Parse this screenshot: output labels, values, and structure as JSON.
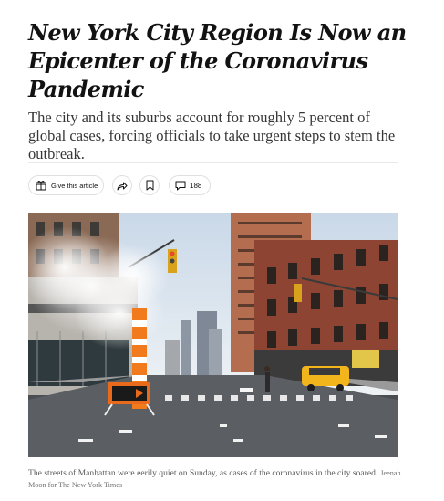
{
  "article": {
    "headline": "New York City Region Is Now an Epicenter of the Coronavirus Pandemic",
    "summary": "The city and its suburbs account for roughly 5 percent of global cases, forcing officials to take urgent steps to stem the outbreak.",
    "toolbar": {
      "gift_label": "Give this article",
      "comment_count": "188",
      "icons": [
        "gift-icon",
        "share-icon",
        "bookmark-icon",
        "comment-icon"
      ]
    },
    "photo": {
      "caption": "The streets of Manhattan were eerily quiet on Sunday, as cases of the coronavirus in the city soared.",
      "credit": "Jeenah Moon for The New York Times"
    }
  },
  "colors": {
    "text": "#121212",
    "summary": "#363636",
    "caption": "#5a5a5a",
    "pill_border": "#dfdfdf",
    "taxi_yellow": "#f2b51c",
    "steam_stack_orange": "#f07a1c"
  }
}
